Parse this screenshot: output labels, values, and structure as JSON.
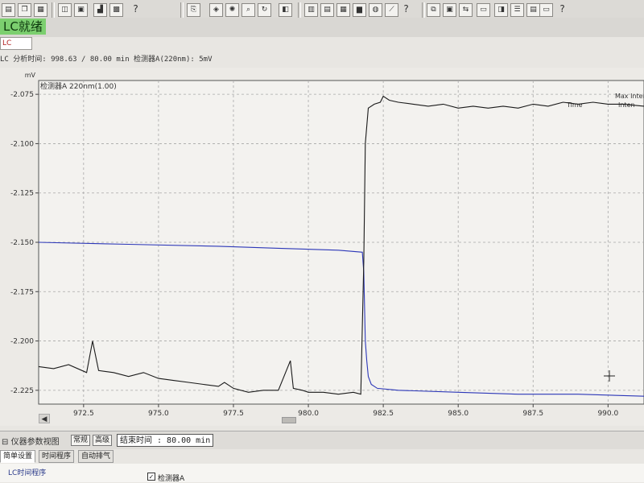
{
  "app": {
    "status_label": "LC就绪",
    "lc_tab_label": "LC",
    "analysis_info": "LC 分析时间: 998.63 / 80.00 min 检测器A(220nm): 5mV"
  },
  "chart_data": {
    "type": "line",
    "detector_label": "检测器A 220nm(1.00)",
    "y_unit": "mV",
    "xlim": [
      971.0,
      991.2
    ],
    "ylim": [
      -2.232,
      -2.068
    ],
    "x_ticks": [
      972.5,
      975.0,
      977.5,
      980.0,
      982.5,
      985.0,
      987.5,
      990.0
    ],
    "x_tick_labels": [
      "972.5",
      "975.0",
      "977.5",
      "980.0",
      "982.5",
      "985.0",
      "987.5",
      "990.0"
    ],
    "y_ticks": [
      -2.075,
      -2.1,
      -2.125,
      -2.15,
      -2.175,
      -2.2,
      -2.225
    ],
    "y_tick_labels": [
      "-2.075",
      "-2.100",
      "-2.125",
      "-2.150",
      "-2.175",
      "-2.200",
      "-2.225"
    ],
    "grid": true,
    "legend_texts": [
      "Max Inter",
      "Time",
      "Inten"
    ],
    "colors": {
      "blue": "#2c37b8",
      "black": "#1a1a1a",
      "grid": "#a8a8a8",
      "plot_bg": "#f3f2ef"
    },
    "series": [
      {
        "color": "blue",
        "x": [
          971.0,
          974.0,
          977.0,
          979.0,
          981.0,
          981.8,
          981.85,
          981.9,
          981.95,
          982.0,
          982.1,
          982.3,
          983.0,
          985.0,
          987.0,
          989.0,
          991.2
        ],
        "y": [
          -2.15,
          -2.151,
          -2.152,
          -2.153,
          -2.154,
          -2.155,
          -2.165,
          -2.2,
          -2.21,
          -2.218,
          -2.222,
          -2.224,
          -2.225,
          -2.226,
          -2.227,
          -2.227,
          -2.228
        ]
      },
      {
        "color": "black",
        "x": [
          971.0,
          971.5,
          972.0,
          972.6,
          972.8,
          973.0,
          973.5,
          974.0,
          974.5,
          975.0,
          975.5,
          976.0,
          976.5,
          977.0,
          977.2,
          977.5,
          978.0,
          978.5,
          979.0,
          979.4,
          979.5,
          979.8,
          980.0,
          980.5,
          981.0,
          981.5,
          981.75,
          981.85,
          981.9,
          982.0,
          982.2,
          982.4,
          982.5,
          982.7,
          983.0,
          983.5,
          984.0,
          984.5,
          985.0,
          985.5,
          986.0,
          986.5,
          987.0,
          987.5,
          988.0,
          988.5,
          989.0,
          989.5,
          990.0,
          990.5,
          991.2
        ],
        "y": [
          -2.213,
          -2.214,
          -2.212,
          -2.216,
          -2.2,
          -2.215,
          -2.216,
          -2.218,
          -2.216,
          -2.219,
          -2.22,
          -2.221,
          -2.222,
          -2.223,
          -2.221,
          -2.224,
          -2.226,
          -2.225,
          -2.225,
          -2.21,
          -2.224,
          -2.225,
          -2.226,
          -2.226,
          -2.227,
          -2.226,
          -2.227,
          -2.16,
          -2.1,
          -2.082,
          -2.08,
          -2.079,
          -2.076,
          -2.078,
          -2.079,
          -2.08,
          -2.081,
          -2.08,
          -2.082,
          -2.081,
          -2.082,
          -2.081,
          -2.082,
          -2.08,
          -2.081,
          -2.079,
          -2.08,
          -2.079,
          -2.08,
          -2.08,
          -2.081
        ]
      }
    ]
  },
  "params": {
    "panel_title": "仪器参数视图",
    "normal_button": "常规",
    "advanced_button": "高级",
    "end_time": "结束时间 : 80.00 min",
    "tabs": [
      "简单设置",
      "时间程序",
      "自动排气"
    ],
    "lc_program": "LC时间程序",
    "detector_checkbox": "检测器A",
    "detector_checked": "✓"
  },
  "toolbar_icons": [
    "file-icon",
    "copy-icon",
    "grid-icon",
    "layout-icon",
    "window-icon",
    "chart-icon",
    "help-icon",
    "report-icon",
    "settings-icon",
    "zoom-icon",
    "refresh-icon",
    "tools-icon",
    "data-icon",
    "monitor-icon"
  ]
}
